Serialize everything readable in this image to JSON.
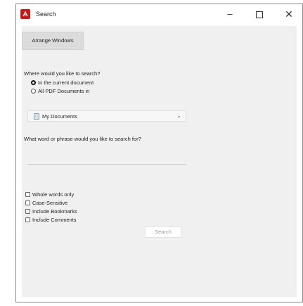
{
  "window": {
    "title": "Search",
    "controls": {
      "minimize": "–",
      "maximize": "",
      "close": "✕"
    }
  },
  "toolbar": {
    "arrange_windows": "Arrange Windows"
  },
  "where": {
    "question": "Where would you like to search?",
    "options": [
      {
        "label": "In the current document",
        "checked": true
      },
      {
        "label": "All PDF Documents in",
        "checked": false
      }
    ],
    "location": {
      "selected": "My Documents"
    }
  },
  "phrase": {
    "question": "What word or phrase would you like to search for?",
    "value": ""
  },
  "options": [
    {
      "label": "Whole words only",
      "checked": false
    },
    {
      "label": "Case-Sensitive",
      "checked": false
    },
    {
      "label": "Include Bookmarks",
      "checked": false
    },
    {
      "label": "Include Comments",
      "checked": false
    }
  ],
  "search_button": "Search",
  "colors": {
    "app_icon": "#c41a1a",
    "panel": "#f0f0f0"
  }
}
